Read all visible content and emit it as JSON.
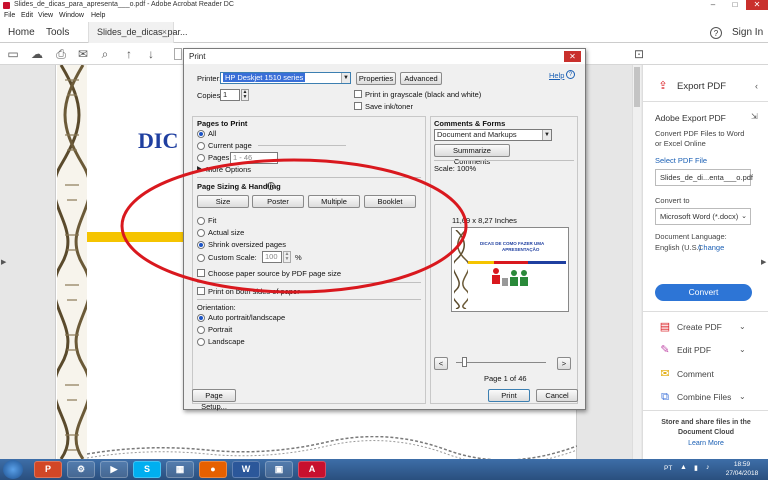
{
  "window": {
    "title": "Slides_de_dicas_para_apresenta___o.pdf - Adobe Acrobat Reader DC",
    "minimize": "–",
    "maximize": "□",
    "close": "✕"
  },
  "menu": [
    "File",
    "Edit",
    "View",
    "Window",
    "Help"
  ],
  "tabs": {
    "home": "Home",
    "tools": "Tools",
    "document": "Slides_de_dicas_par...",
    "close": "×",
    "help": "?",
    "signin": "Sign In"
  },
  "document": {
    "title_fragment": "DIC"
  },
  "right_pane": {
    "export_pdf": "Export PDF",
    "adobe_export_title": "Adobe Export PDF",
    "adobe_export_desc_1": "Convert PDF Files to Word",
    "adobe_export_desc_2": "or Excel Online",
    "select_pdf_label": "Select PDF File",
    "selected_file": "Slides_de_di...enta___o.pdf",
    "convert_to_label": "Convert to",
    "convert_to_value": "Microsoft Word (*.docx)",
    "doc_language_label": "Document Language:",
    "doc_language_value": "English (U.S.)",
    "change_link": "Change",
    "convert_button": "Convert",
    "tools": [
      "Create PDF",
      "Edit PDF",
      "Comment",
      "Combine Files"
    ],
    "store_line1": "Store and share files in the",
    "store_line2": "Document Cloud",
    "learn_more": "Learn More"
  },
  "print_dialog": {
    "title": "Print",
    "close": "✕",
    "help_link": "Help",
    "printer_label": "Printer:",
    "printer_value": "HP Deskjet 1510 series",
    "properties_button": "Properties",
    "advanced_button": "Advanced",
    "copies_label": "Copies:",
    "copies_value": "1",
    "grayscale_label": "Print in grayscale (black and white)",
    "ink_toner_label": "Save ink/toner",
    "pages_to_print_heading": "Pages to Print",
    "all_label": "All",
    "current_page_label": "Current page",
    "pages_label": "Pages",
    "pages_value": "1 - 46",
    "more_options": "More Options",
    "sizing_heading": "Page Sizing & Handling",
    "size_button": "Size",
    "poster_button": "Poster",
    "multiple_button": "Multiple",
    "booklet_button": "Booklet",
    "fit_label": "Fit",
    "actual_size_label": "Actual size",
    "shrink_label": "Shrink oversized pages",
    "custom_scale_label": "Custom Scale:",
    "custom_scale_value": "100",
    "percent": "%",
    "paper_source_label": "Choose paper source by PDF page size",
    "both_sides_label": "Print on both sides of paper",
    "orientation_heading": "Orientation:",
    "auto_orientation_label": "Auto portrait/landscape",
    "portrait_label": "Portrait",
    "landscape_label": "Landscape",
    "comments_heading": "Comments & Forms",
    "comments_value": "Document and Markups",
    "summarize_button": "Summarize Comments",
    "scale_text": "Scale: 100%",
    "dimensions_text": "11,69 x 8,27 Inches",
    "preview_title_1": "DICAS DE COMO FAZER UMA",
    "preview_title_2": "APRESENTAÇÃO",
    "prev_button": "<",
    "next_button": ">",
    "page_indicator": "Page 1 of 46",
    "page_setup_button": "Page Setup...",
    "print_button": "Print",
    "cancel_button": "Cancel"
  },
  "taskbar": {
    "apps": [
      "P",
      "⚙",
      "▶",
      "S",
      "▦",
      "●",
      "W",
      "▣",
      "A"
    ],
    "language": "PT",
    "time": "18:59",
    "date": "27/04/2018"
  },
  "colors": {
    "accent": "#2d75d6",
    "annotation_red": "#d9181e",
    "title_blue": "#1f3fa0",
    "printer_highlight": "#3a6fd8"
  }
}
